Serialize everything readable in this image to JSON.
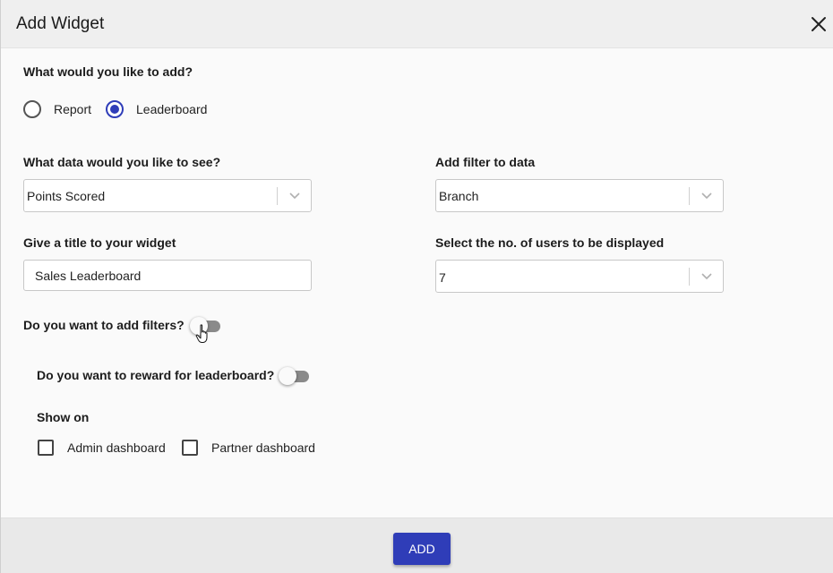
{
  "dialog": {
    "title": "Add Widget",
    "close_icon": "close-icon"
  },
  "widget_type": {
    "question": "What would you like to add?",
    "options": [
      {
        "label": "Report",
        "checked": false
      },
      {
        "label": "Leaderboard",
        "checked": true
      }
    ]
  },
  "data_select": {
    "label": "What data would you like to see?",
    "value": "Points Scored"
  },
  "filter_select": {
    "label": "Add filter to data",
    "value": "Branch"
  },
  "title_input": {
    "label": "Give a title to your widget",
    "value": "Sales Leaderboard"
  },
  "users_select": {
    "label": "Select the no. of users to be displayed",
    "value": "7"
  },
  "filters_toggle": {
    "label": "Do you want to add filters?",
    "on": false
  },
  "reward_toggle": {
    "label": "Do you want to reward for leaderboard?",
    "on": false
  },
  "show_on": {
    "label": "Show on",
    "options": [
      {
        "label": "Admin dashboard",
        "checked": false
      },
      {
        "label": "Partner dashboard",
        "checked": false
      }
    ]
  },
  "footer": {
    "add_label": "ADD"
  },
  "colors": {
    "accent": "#2f3db8",
    "toggle_track": "#8a8a8a"
  }
}
